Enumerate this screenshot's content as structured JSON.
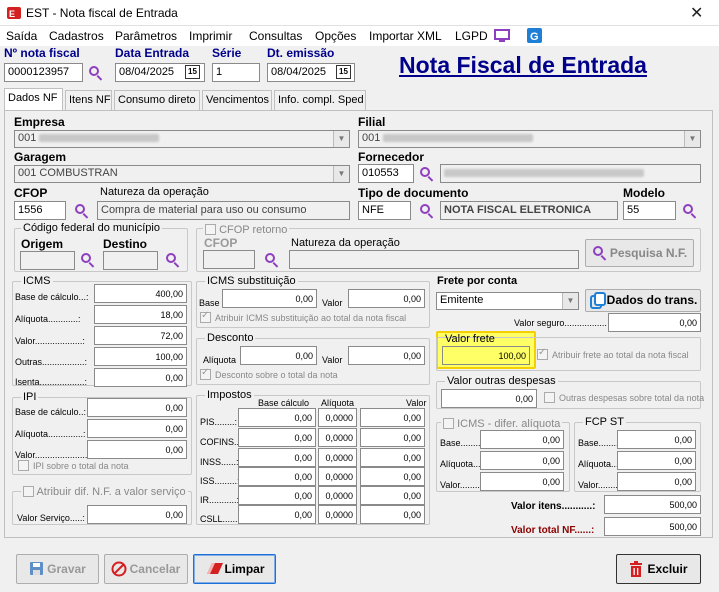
{
  "window": {
    "title": "EST - Nota fiscal de Entrada",
    "close": "✕"
  },
  "menu": [
    "Saída",
    "Cadastros",
    "Parâmetros",
    "Imprimir",
    "Consultas",
    "Opções",
    "Importar XML",
    "LGPD"
  ],
  "header": {
    "nota_label": "Nº nota fiscal",
    "nota_value": "0000123957",
    "data_entrada_label": "Data Entrada",
    "data_entrada_value": "08/04/2025",
    "serie_label": "Série",
    "serie_value": "1",
    "dt_emissao_label": "Dt. emissão",
    "dt_emissao_value": "08/04/2025",
    "big_title": "Nota Fiscal de Entrada",
    "cal_glyph": "15"
  },
  "tabs": [
    "Dados NF",
    "Itens NF",
    "Consumo direto",
    "Vencimentos",
    "Info. compl. Sped"
  ],
  "dados": {
    "empresa_label": "Empresa",
    "empresa_value": "001",
    "filial_label": "Filial",
    "filial_value": "001",
    "garagem_label": "Garagem",
    "garagem_value": "001 COMBUSTRAN",
    "fornecedor_label": "Fornecedor",
    "fornecedor_value": "010553",
    "cfop_label": "CFOP",
    "cfop_value": "1556",
    "natureza_label": "Natureza da operação",
    "natureza_value": "Compra de material para uso ou consumo",
    "tipo_doc_label": "Tipo de documento",
    "tipo_doc_value": "NFE",
    "tipo_doc_desc": "NOTA FISCAL ELETRONICA",
    "modelo_label": "Modelo",
    "modelo_value": "55"
  },
  "municipio": {
    "title": "Código federal do município",
    "origem": "Origem",
    "destino": "Destino"
  },
  "cfop_retorno": {
    "title": "CFOP retorno",
    "cfop": "CFOP",
    "natureza": "Natureza da operação",
    "pesquisa_btn": "Pesquisa N.F."
  },
  "icms": {
    "title": "ICMS",
    "rows": [
      {
        "label": "Base de cálculo...:",
        "value": "400,00"
      },
      {
        "label": "Alíquota............:",
        "value": "18,00"
      },
      {
        "label": "Valor...................:",
        "value": "72,00"
      },
      {
        "label": "Outras.................:",
        "value": "100,00"
      },
      {
        "label": "Isenta..................:",
        "value": "0,00"
      }
    ]
  },
  "icms_st": {
    "title": "ICMS substituição",
    "base": "Base",
    "base_value": "0,00",
    "valor": "Valor",
    "valor_value": "0,00",
    "check": "Atribuir ICMS substituição ao total da nota fiscal"
  },
  "desconto": {
    "title": "Desconto",
    "aliquota": "Alíquota",
    "aliquota_value": "0,00",
    "valor": "Valor",
    "valor_value": "0,00",
    "check": "Desconto sobre o total da nota"
  },
  "ipi": {
    "title": "IPI",
    "rows": [
      {
        "label": "Base de cálculo..:",
        "value": "0,00"
      },
      {
        "label": "Alíquota..............:",
        "value": "0,00"
      },
      {
        "label": "Valor.....................:",
        "value": "0,00"
      }
    ],
    "check": "IPI sobre o total da nota"
  },
  "atribuir_dif": {
    "title": "Atribuir dif. N.F. a valor serviço",
    "label": "Valor Serviço.....:",
    "value": "0,00"
  },
  "impostos": {
    "title": "Impostos",
    "headers": [
      "Base cálculo",
      "Alíquota",
      "Valor"
    ],
    "rows": [
      {
        "label": "PIS........:",
        "base": "0,00",
        "aliq": "0,0000",
        "valor": "0,00"
      },
      {
        "label": "COFINS..:",
        "base": "0,00",
        "aliq": "0,0000",
        "valor": "0,00"
      },
      {
        "label": "INSS......:",
        "base": "0,00",
        "aliq": "0,0000",
        "valor": "0,00"
      },
      {
        "label": "ISS.........:",
        "base": "0,00",
        "aliq": "0,0000",
        "valor": "0,00"
      },
      {
        "label": "IR...........:",
        "base": "0,00",
        "aliq": "0,0000",
        "valor": "0,00"
      },
      {
        "label": "CSLL.......:",
        "base": "0,00",
        "aliq": "0,0000",
        "valor": "0,00"
      }
    ]
  },
  "frete": {
    "title": "Frete por conta",
    "value": "Emitente",
    "dados_btn": "Dados do trans.",
    "seguro_label": "Valor seguro.................",
    "seguro_value": "0,00",
    "valor_frete_label": "Valor frete",
    "valor_frete_value": "100,00",
    "frete_check": "Atribuir frete ao total da nota fiscal",
    "outras_title": "Valor outras despesas",
    "outras_value": "0,00",
    "outras_check": "Outras despesas sobre total da nota"
  },
  "icms_dif": {
    "title": "ICMS - difer. alíquota",
    "rows": [
      {
        "label": "Base.........:",
        "value": "0,00"
      },
      {
        "label": "Alíquota....:",
        "value": "0,00"
      },
      {
        "label": "Valor.........:",
        "value": "0,00"
      }
    ]
  },
  "fcp": {
    "title": "FCP ST",
    "rows": [
      {
        "label": "Base.........:",
        "value": "0,00"
      },
      {
        "label": "Alíquota....:",
        "value": "0,00"
      },
      {
        "label": "Valor.........:",
        "value": "0,00"
      }
    ]
  },
  "totais": {
    "itens_label": "Valor itens...........:",
    "itens_value": "500,00",
    "total_label": "Valor total NF......:",
    "total_value": "500,00"
  },
  "buttons": {
    "gravar": "Gravar",
    "cancelar": "Cancelar",
    "limpar": "Limpar",
    "excluir": "Excluir"
  }
}
